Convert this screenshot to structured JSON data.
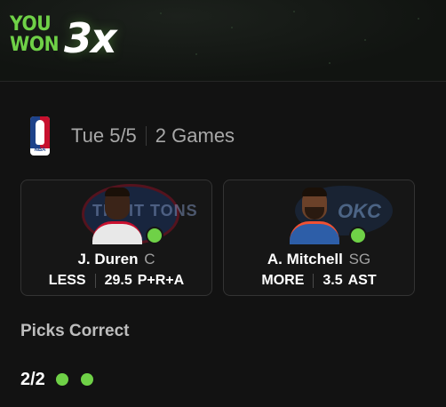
{
  "banner": {
    "line1": "YOU",
    "line2": "WON",
    "multiplier": "3x"
  },
  "header": {
    "league_icon": "nba-logo-icon",
    "date": "Tue 5/5",
    "games": "2 Games"
  },
  "picks": [
    {
      "player": "J. Duren",
      "position": "C",
      "direction": "LESS",
      "line": "29.5",
      "stat": "P+R+A",
      "team_logo_text": "TROIT TONS",
      "result": "correct"
    },
    {
      "player": "A. Mitchell",
      "position": "SG",
      "direction": "MORE",
      "line": "3.5",
      "stat": "AST",
      "team_logo_text": "OKC",
      "result": "correct"
    }
  ],
  "summary": {
    "label": "Picks Correct",
    "count": "2/2",
    "correct_dots": 2
  },
  "colors": {
    "accent": "#6fd147",
    "background": "#121212",
    "card": "#161616",
    "muted": "#a8a8a8"
  }
}
